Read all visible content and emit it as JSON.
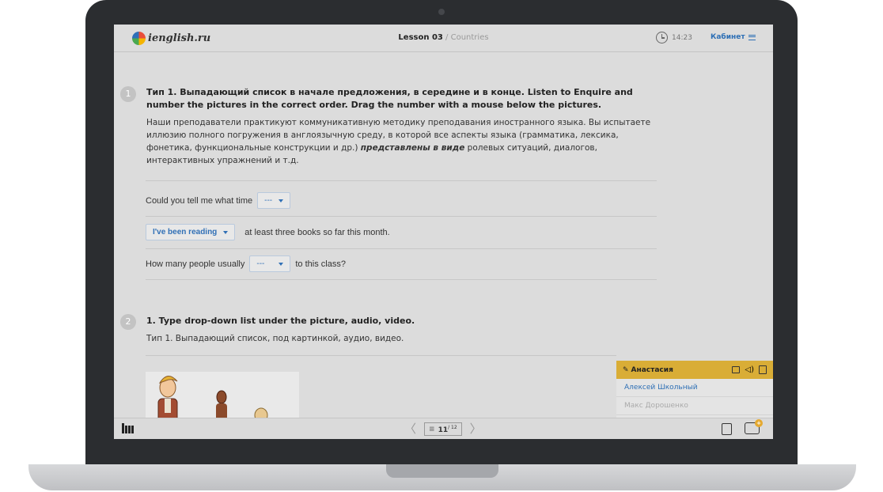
{
  "header": {
    "logo_text": "ienglish.ru",
    "lesson_label": "Lesson 03",
    "lesson_separator": " / ",
    "lesson_topic": "Countries",
    "time": "14:23",
    "cabinet_label": "Кабинет"
  },
  "tasks": [
    {
      "number": "1",
      "title": "Тип 1. Выпадающий список в начале предложения, в середине и в конце. Listen to Enquire and number the pictures in the correct order. Drag the number with a mouse below the pictures.",
      "description_before": "Наши преподаватели практикуют коммуникативную методику преподавания иностранного языка. Вы испытаете иллюзию полного погружения в англоязычную среду, в которой все аспекты языка (грамматика, лексика, фонетика, функциональные конструкции и др.) ",
      "description_emphasis": "представлены в виде",
      "description_after": " ролевых ситуаций, диалогов, интерактивных упражнений и т.д.",
      "sentences": [
        {
          "before": "Could you tell me what time",
          "dropdown": "---",
          "after": ""
        },
        {
          "before": "",
          "dropdown": "I've been reading",
          "after": "at least three books so far this month."
        },
        {
          "before": "How many people usually",
          "dropdown": "---",
          "after": "to this class?"
        }
      ]
    },
    {
      "number": "2",
      "title": "1. Type drop-down list under the picture, audio, video.",
      "description": "Тип 1. Выпадающий список, под картинкой, аудио, видео."
    }
  ],
  "chat": {
    "active_user": "Анастасия",
    "users": [
      "Алексей Школьный",
      "Макс Дорошенко"
    ]
  },
  "footer": {
    "current_page": "11",
    "total_pages": "/ 12"
  },
  "colors": {
    "accent": "#2d6fb5",
    "chat_header": "#d9ad36",
    "laptop_frame": "#2b2d30"
  }
}
